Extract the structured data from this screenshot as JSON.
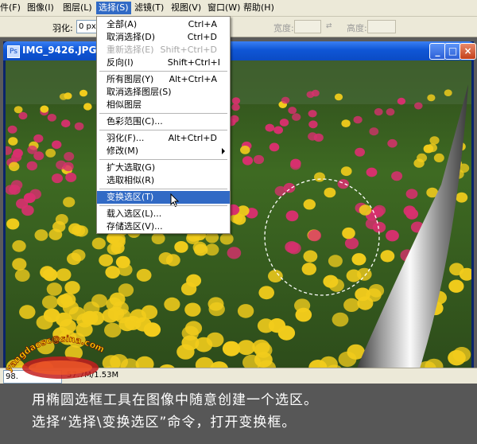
{
  "menubar": {
    "items": [
      {
        "label": "文件(F)",
        "key": "file"
      },
      {
        "label": "图像(I)",
        "key": "image"
      },
      {
        "label": "图层(L)",
        "key": "layer"
      },
      {
        "label": "选择(S)",
        "key": "select"
      },
      {
        "label": "滤镜(T)",
        "key": "filter"
      },
      {
        "label": "视图(V)",
        "key": "view"
      },
      {
        "label": "窗口(W)",
        "key": "window"
      },
      {
        "label": "帮助(H)",
        "key": "help"
      }
    ]
  },
  "options": {
    "feather_label": "羽化:",
    "feather_value": "0 px",
    "width_label": "宽度:",
    "height_label": "高度:"
  },
  "document": {
    "title": "IMG_9426.JPG @",
    "zoom": "98.",
    "doc_info": "57.7M/1.53M"
  },
  "select_menu": {
    "items": [
      {
        "label": "全部(A)",
        "shortcut": "Ctrl+A"
      },
      {
        "label": "取消选择(D)",
        "shortcut": "Ctrl+D"
      },
      {
        "label": "重新选择(E)",
        "shortcut": "Shift+Ctrl+D"
      },
      {
        "label": "反向(I)",
        "shortcut": "Shift+Ctrl+I"
      },
      {
        "label": "所有图层(Y)",
        "shortcut": "Alt+Ctrl+A"
      },
      {
        "label": "取消选择图层(S)",
        "shortcut": ""
      },
      {
        "label": "相似图层",
        "shortcut": ""
      },
      {
        "label": "色彩范围(C)...",
        "shortcut": ""
      },
      {
        "label": "羽化(F)...",
        "shortcut": "Alt+Ctrl+D"
      },
      {
        "label": "修改(M)",
        "shortcut": ""
      },
      {
        "label": "扩大选取(G)",
        "shortcut": ""
      },
      {
        "label": "选取相似(R)",
        "shortcut": ""
      },
      {
        "label": "变换选区(T)",
        "shortcut": ""
      },
      {
        "label": "载入选区(L)...",
        "shortcut": ""
      },
      {
        "label": "存储选区(V)...",
        "shortcut": ""
      }
    ]
  },
  "watermark": {
    "text": "yangdaosc@sina.com"
  },
  "caption": {
    "line1": "用椭圆选框工具在图像中随意创建一个选区。",
    "line2": "选择“选择\\变换选区”命令，打开变换框。"
  },
  "colors": {
    "highlight": "#316ac5",
    "menubar_bg": "#ece9d8",
    "caption_bg": "#575757",
    "tulip_yellow": "#f2cc1c",
    "tulip_pink": "#d8306e"
  }
}
